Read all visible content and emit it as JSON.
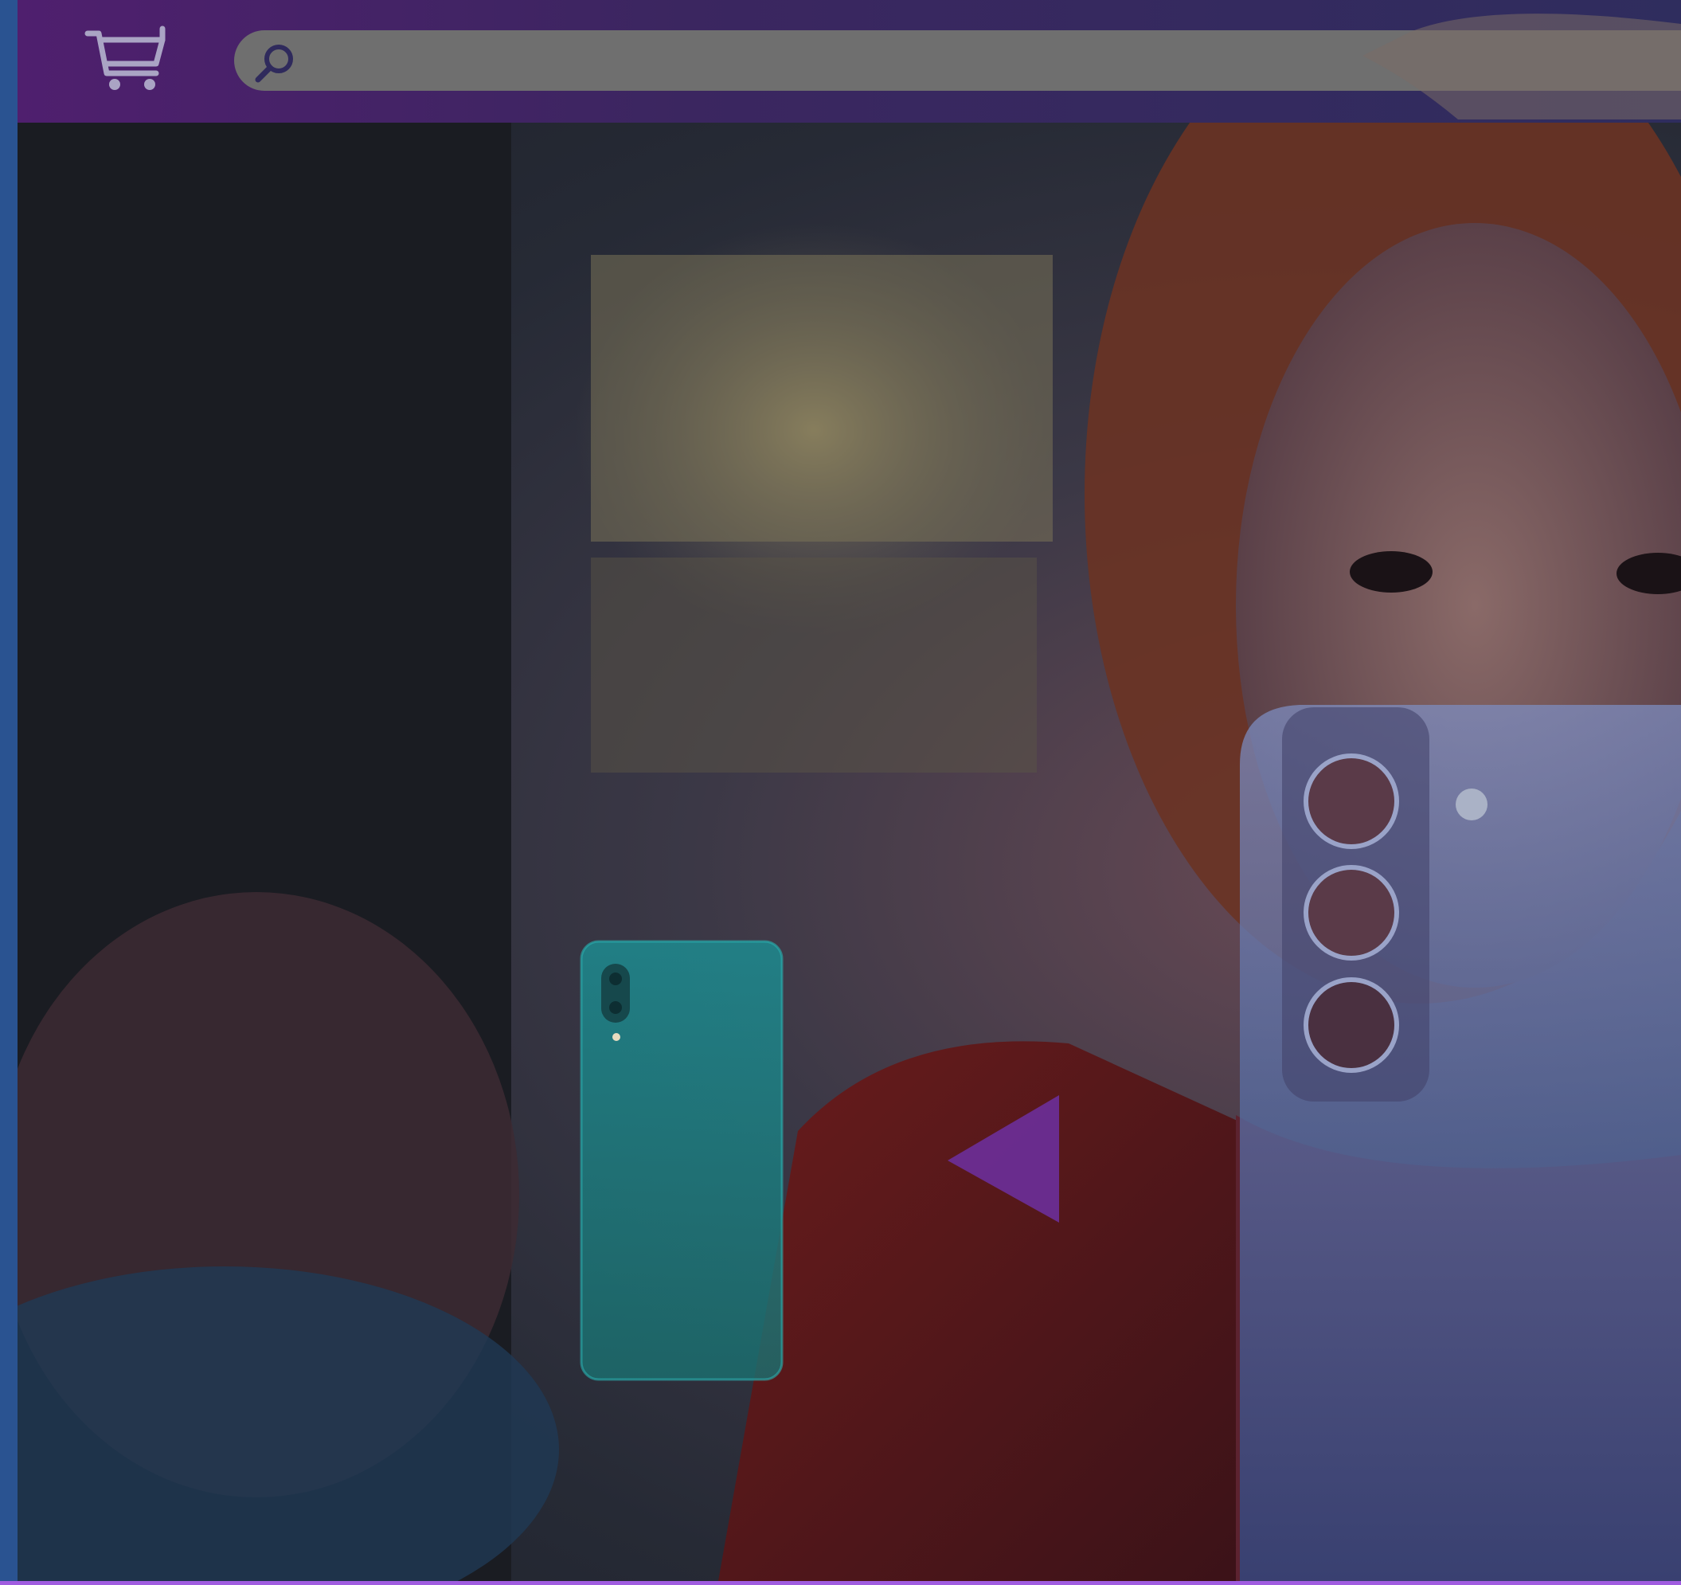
{
  "header": {
    "cart_icon": "shopping-cart-icon",
    "search": {
      "icon": "search-icon",
      "value": "",
      "placeholder": ""
    }
  },
  "hero": {
    "previous_arrow_icon": "triangle-left-icon",
    "colors": {
      "accent": "#6b2f9a",
      "topbar": "#3b2660",
      "frame": "#2a5391",
      "phone_small": "#1f8a8a",
      "phone_large": "#5b6fa8"
    }
  }
}
